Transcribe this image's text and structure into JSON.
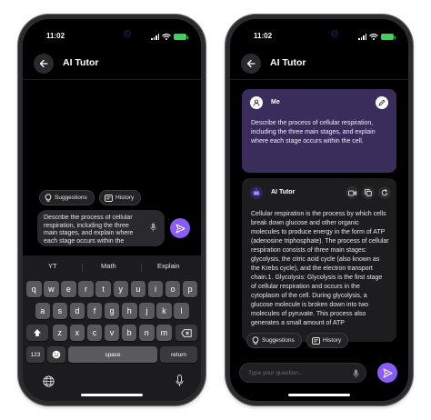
{
  "status": {
    "time": "11:02"
  },
  "header": {
    "title": "AI Tutor"
  },
  "chips": {
    "suggestions": "Suggestions",
    "history": "History"
  },
  "left": {
    "input_text": "Describe the process of cellular respiration, including the three main stages, and explain where each stage occurs within the",
    "keyboard": {
      "suggestions": [
        "YT",
        "Math",
        "Explain"
      ],
      "row1": [
        "q",
        "w",
        "e",
        "r",
        "t",
        "y",
        "u",
        "i",
        "o",
        "p"
      ],
      "row2": [
        "a",
        "s",
        "d",
        "f",
        "g",
        "h",
        "j",
        "k",
        "l"
      ],
      "row3": [
        "z",
        "x",
        "c",
        "v",
        "b",
        "n",
        "m"
      ],
      "numbers_key": "123",
      "space_key": "space",
      "return_key": "return"
    }
  },
  "right": {
    "user_name": "Me",
    "user_message": "Describe the process of cellular respiration, including the three main stages, and explain where each stage occurs within the cell.",
    "ai_name": "AI Tutor",
    "ai_message": "Cellular respiration is the process by which cells break down glucose and other organic molecules to produce energy in the form of ATP (adenosine triphosphate). The process of cellular respiration consists of three main stages: glycolysis, the citric acid cycle (also known as the Krebs cycle), and the electron transport chain.1. Glycolysis: Glycolysis is the first stage of cellular respiration and occurs in the cytoplasm of the cell. During glycolysis, a glucose molecule is broken down into two molecules of pyruvate. This process also generates a small amount of ATP",
    "input_placeholder": "Type your question..."
  },
  "colors": {
    "accent": "#8a5cf6",
    "user_card": "#3a2d5c",
    "battery": "#3dd35a"
  },
  "icons": [
    "back-arrow-icon",
    "lightbulb-icon",
    "history-icon",
    "mic-icon",
    "send-icon",
    "user-icon",
    "edit-icon",
    "ai-avatar-icon",
    "video-icon",
    "copy-icon",
    "refresh-icon",
    "emoji-icon",
    "globe-icon",
    "shift-icon",
    "backspace-icon"
  ]
}
